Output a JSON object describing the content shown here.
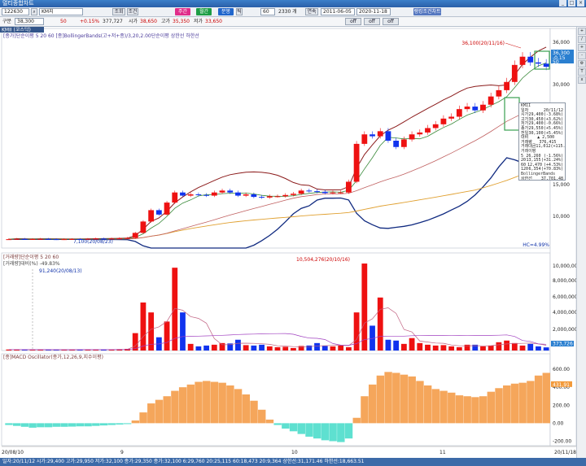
{
  "window": {
    "title": "멀티종합차트"
  },
  "toolbar1": {
    "code": "122630",
    "name": "KM지",
    "btn_inquiry": "조회",
    "btn_top": "조건",
    "btn_a": "주간",
    "btn_b": "월간",
    "btn_c": "분봉",
    "btn_d": "틱",
    "btn_e": "틱봉",
    "btn_f": "분틱",
    "interval": "60",
    "count": "2330 개",
    "btn_yeon": "연속",
    "date_from": "2011-06-05",
    "date_to": "2020-11-18",
    "btn_ranking": "랭킹조건차트"
  },
  "toolbar2": {
    "gubun": "구분",
    "price": "38,300",
    "change": "50",
    "pct": "+0.15%",
    "volume": "377,727",
    "open_lbl": "시가",
    "open": "38,650",
    "high_lbl": "고가",
    "high": "35,350",
    "low_lbl": "저가",
    "low": "33,650",
    "btn_off1": "off",
    "btn_off2": "off",
    "btn_off3": "off"
  },
  "legends": {
    "main_tab": "KMII (코스닥)",
    "main": "[종가]단순이평 5 20 60  [종]BollingerBands(고+저+종)/3,20,2.00단순이평   상한선  하한선",
    "volume": "[거래량]단순이평 5 20 60",
    "volume2": "[거래량]대비(%) -49.83%",
    "macd": "[종]MACD Oscillator(종가,12,26,9,지수이평)"
  },
  "annotations": {
    "max_price": "36,100(20/11/16)",
    "min_price": "7,100(20/08/23)",
    "max_vol": "10,504,276(20/10/16)",
    "min_vol": "91,240(20/08/13)",
    "hc": "HC=4.99%"
  },
  "axes": {
    "price_ticks": [
      "36,000",
      "30,000",
      "15,000",
      "10,000"
    ],
    "price_current": "36,300",
    "price_current_sub": "-0.15",
    "price_current_sub2": "50",
    "vol_ticks": [
      "10,000,000",
      "8,000,000",
      "6,000,000",
      "4,000,000",
      "2,000,000"
    ],
    "vol_current": "373,726",
    "macd_ticks": [
      "600.00",
      "400.00",
      "200.00",
      "0.00",
      "-200.00"
    ],
    "macd_current": "431.91",
    "x_ticks": [
      "20/08/10",
      "9",
      "10",
      "11",
      "20/11/18"
    ]
  },
  "infobox": {
    "title": "KMII",
    "date_lbl": "일자",
    "date": "20/11/12",
    "rows": [
      [
        "시가",
        "29,400",
        "(-3.68%)"
      ],
      [
        "고가",
        "30,450",
        "(+3.62%)"
      ],
      [
        "저가",
        "29,400",
        "(-0.66%)"
      ],
      [
        "종가",
        "29,550",
        "(+5.45%)"
      ],
      [
        "전일",
        "30,100",
        "(+5.45%)"
      ],
      [
        "대비",
        "▲ 2,500",
        ""
      ],
      [
        "거래량",
        "376,415",
        ""
      ],
      [
        "거래대금",
        "11,012",
        "(+115.89%)"
      ]
    ],
    "ma_title": "거래이평",
    "ma_rows": [
      [
        "5",
        "26,260",
        "(-1.56%)"
      ],
      [
        "20",
        "13,155",
        "(+31.24%)"
      ],
      [
        "60",
        "12,470",
        "(+4.53%)"
      ],
      [
        "120",
        "6,354",
        "(+70.83%)"
      ]
    ],
    "bb_title": "BollingerBands",
    "bb_rows": [
      [
        "상한선",
        "37,701.48"
      ],
      [
        "하한선",
        "19,085.51"
      ]
    ]
  },
  "statusbar": {
    "text": "일자:20/11/12 시가:29,400 고가:29,950 저가:32,100 종가:29,350 종가:32,100 6:29,760 20:25,115 60:18,473 20:9,364 상한선:31,171.46 하한선:18,663.51"
  },
  "chart_data": {
    "type": "candlestick",
    "price_series": "OHLC daily candles, red=up blue=down, with moving averages 5/20/60 and Bollinger Bands",
    "ylim_price": [
      6000,
      40000
    ],
    "ylim_volume": [
      0,
      11000000
    ],
    "ylim_macd": [
      -250,
      700
    ],
    "x": [
      "08/10",
      "08/11",
      "08/12",
      "08/13",
      "08/14",
      "08/17",
      "08/18",
      "08/19",
      "08/20",
      "08/21",
      "08/24",
      "08/25",
      "08/26",
      "08/27",
      "08/28",
      "08/31",
      "09/01",
      "09/02",
      "09/03",
      "09/04",
      "09/07",
      "09/08",
      "09/09",
      "09/10",
      "09/11",
      "09/14",
      "09/15",
      "09/16",
      "09/17",
      "09/18",
      "09/21",
      "09/22",
      "09/23",
      "09/24",
      "09/25",
      "09/28",
      "09/29",
      "10/05",
      "10/06",
      "10/07",
      "10/08",
      "10/12",
      "10/13",
      "10/14",
      "10/15",
      "10/16",
      "10/19",
      "10/20",
      "10/21",
      "10/22",
      "10/23",
      "10/26",
      "10/27",
      "10/28",
      "10/29",
      "10/30",
      "11/02",
      "11/03",
      "11/04",
      "11/05",
      "11/06",
      "11/09",
      "11/10",
      "11/11",
      "11/12",
      "11/13",
      "11/16",
      "11/17",
      "11/18"
    ],
    "close": [
      7400,
      7450,
      7400,
      7420,
      7450,
      7400,
      7380,
      7400,
      7420,
      7400,
      7450,
      7500,
      7480,
      7500,
      7550,
      7600,
      8400,
      10200,
      12000,
      11300,
      13200,
      14800,
      14300,
      14500,
      14400,
      14300,
      14800,
      15100,
      14800,
      14300,
      14500,
      14100,
      14000,
      14200,
      14200,
      14400,
      14600,
      15100,
      15000,
      14900,
      14700,
      14800,
      14800,
      16500,
      22500,
      24000,
      23700,
      24500,
      23000,
      22000,
      23200,
      24000,
      24300,
      25000,
      25600,
      26500,
      26800,
      28000,
      28400,
      27800,
      28700,
      30000,
      31000,
      32300,
      35000,
      36300,
      35400,
      35200,
      34700
    ],
    "volume": [
      120000,
      110000,
      95000,
      91240,
      100000,
      105000,
      98000,
      97000,
      110000,
      120000,
      115000,
      112000,
      108000,
      130000,
      160000,
      200000,
      2100000,
      5800000,
      4600000,
      1600000,
      3500000,
      10000000,
      4600000,
      800000,
      500000,
      600000,
      700000,
      900000,
      850000,
      1300000,
      650000,
      600000,
      700000,
      500000,
      400000,
      450000,
      300000,
      550000,
      600000,
      900000,
      550000,
      500000,
      600000,
      400000,
      4600000,
      10504276,
      3000000,
      6400000,
      1300000,
      1200000,
      800000,
      1500000,
      900000,
      700000,
      600000,
      650000,
      500000,
      400000,
      700000,
      700000,
      500000,
      600000,
      1000000,
      1200000,
      900000,
      600000,
      800000,
      500000,
      377727
    ],
    "macd_osc": [
      -20,
      -30,
      -40,
      -50,
      -45,
      -45,
      -40,
      -40,
      -38,
      -35,
      -35,
      -30,
      -25,
      -20,
      -15,
      -10,
      30,
      120,
      220,
      260,
      300,
      360,
      400,
      430,
      460,
      470,
      460,
      450,
      420,
      380,
      320,
      250,
      150,
      40,
      -20,
      -60,
      -90,
      -120,
      -150,
      -170,
      -190,
      -200,
      -210,
      -170,
      60,
      300,
      430,
      530,
      570,
      560,
      540,
      520,
      470,
      420,
      380,
      360,
      340,
      310,
      300,
      290,
      300,
      350,
      390,
      420,
      440,
      450,
      470,
      530,
      560,
      520,
      430
    ]
  }
}
